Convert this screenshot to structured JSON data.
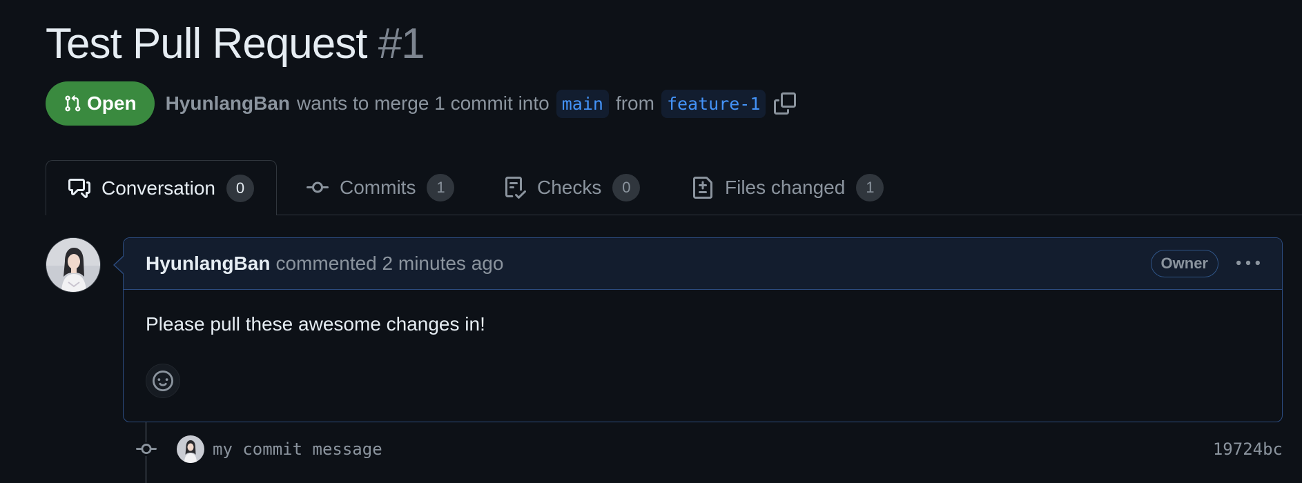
{
  "pr": {
    "title": "Test Pull Request",
    "number": "#1",
    "state": "Open",
    "author": "HyunlangBan",
    "merge_text": "wants to merge 1 commit into",
    "base_branch": "main",
    "from_text": "from",
    "head_branch": "feature-1"
  },
  "tabs": [
    {
      "label": "Conversation",
      "count": "0",
      "icon": "comment-discussion-icon",
      "active": true
    },
    {
      "label": "Commits",
      "count": "1",
      "icon": "git-commit-icon",
      "active": false
    },
    {
      "label": "Checks",
      "count": "0",
      "icon": "checklist-icon",
      "active": false
    },
    {
      "label": "Files changed",
      "count": "1",
      "icon": "file-diff-icon",
      "active": false
    }
  ],
  "comment": {
    "author": "HyunlangBan",
    "meta": "commented 2 minutes ago",
    "role": "Owner",
    "body": "Please pull these awesome changes in!"
  },
  "commit": {
    "message": "my commit message",
    "sha": "19724bc"
  },
  "colors": {
    "background": "#0d1117",
    "open_badge": "#3a8a3f",
    "branch_text": "#4493f8",
    "comment_border": "#2c4c80",
    "comment_header_bg": "#131d2e",
    "muted_text": "#8b949e"
  }
}
